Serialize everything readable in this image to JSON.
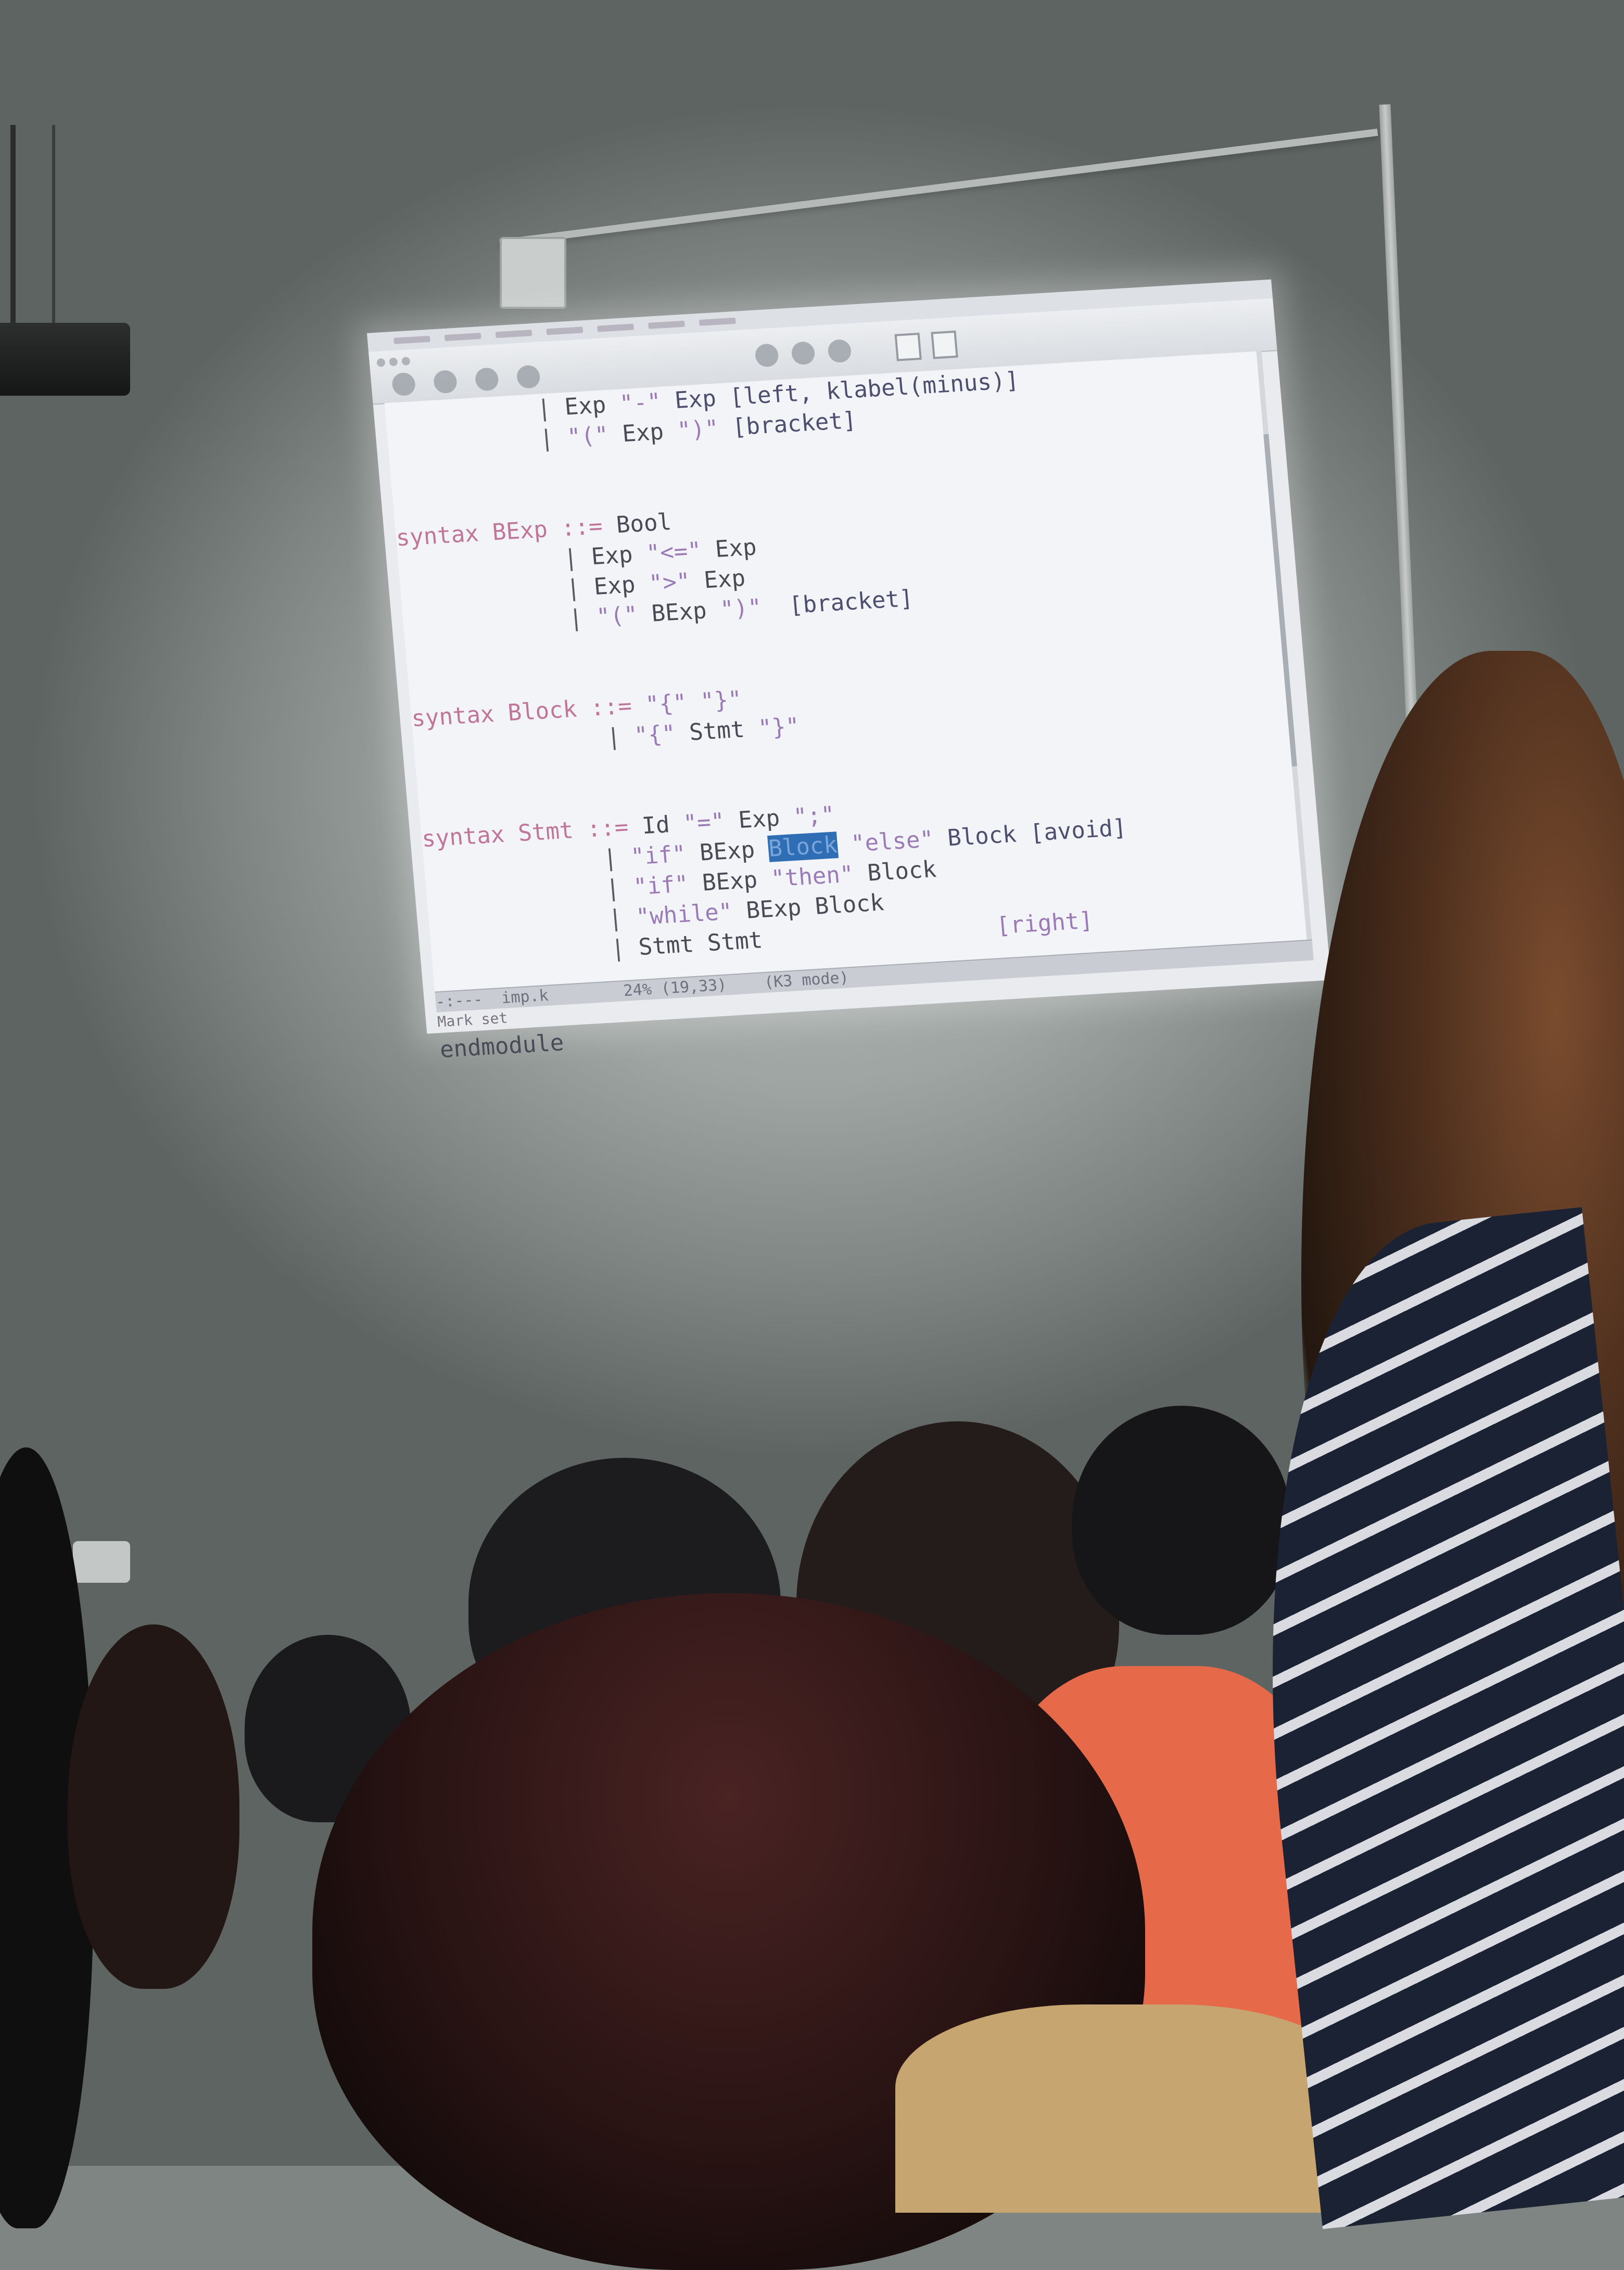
{
  "scene": {
    "description_free": true
  },
  "editor": {
    "code_lines": [
      {
        "parts": [
          {
            "t": "           ",
            "c": ""
          },
          {
            "t": "| ",
            "c": "bar"
          },
          {
            "t": "Exp ",
            "c": ""
          },
          {
            "t": "\"-\"",
            "c": "str"
          },
          {
            "t": " Exp [left, klabel(minus)]",
            "c": "attr"
          }
        ]
      },
      {
        "parts": [
          {
            "t": "           ",
            "c": ""
          },
          {
            "t": "| ",
            "c": "bar"
          },
          {
            "t": "\"(\"",
            "c": "str"
          },
          {
            "t": " Exp ",
            "c": ""
          },
          {
            "t": "\")\"",
            "c": "str"
          },
          {
            "t": " [bracket]",
            "c": "attr"
          }
        ]
      },
      {
        "parts": [
          {
            "t": "",
            "c": ""
          }
        ]
      },
      {
        "parts": [
          {
            "t": "",
            "c": ""
          }
        ]
      },
      {
        "parts": [
          {
            "t": "syntax BExp",
            "c": "kw"
          },
          {
            "t": " ::= ",
            "c": "kw"
          },
          {
            "t": "Bool",
            "c": ""
          }
        ]
      },
      {
        "parts": [
          {
            "t": "            ",
            "c": ""
          },
          {
            "t": "| ",
            "c": "bar"
          },
          {
            "t": "Exp ",
            "c": ""
          },
          {
            "t": "\"<=\"",
            "c": "str"
          },
          {
            "t": " Exp",
            "c": ""
          }
        ]
      },
      {
        "parts": [
          {
            "t": "            ",
            "c": ""
          },
          {
            "t": "| ",
            "c": "bar"
          },
          {
            "t": "Exp ",
            "c": ""
          },
          {
            "t": "\">\"",
            "c": "str"
          },
          {
            "t": " Exp",
            "c": ""
          }
        ]
      },
      {
        "parts": [
          {
            "t": "            ",
            "c": ""
          },
          {
            "t": "| ",
            "c": "bar"
          },
          {
            "t": "\"(\"",
            "c": "str"
          },
          {
            "t": " BExp ",
            "c": ""
          },
          {
            "t": "\")\"",
            "c": "str"
          },
          {
            "t": "  [bracket]",
            "c": "attr"
          }
        ]
      },
      {
        "parts": [
          {
            "t": "",
            "c": ""
          }
        ]
      },
      {
        "parts": [
          {
            "t": "",
            "c": ""
          }
        ]
      },
      {
        "parts": [
          {
            "t": "syntax Block",
            "c": "kw"
          },
          {
            "t": " ::= ",
            "c": "kw"
          },
          {
            "t": "\"{\" \"}\"",
            "c": "str"
          }
        ]
      },
      {
        "parts": [
          {
            "t": "              ",
            "c": ""
          },
          {
            "t": "| ",
            "c": "bar"
          },
          {
            "t": "\"{\"",
            "c": "str"
          },
          {
            "t": " Stmt ",
            "c": ""
          },
          {
            "t": "\"}\"",
            "c": "str"
          }
        ]
      },
      {
        "parts": [
          {
            "t": "",
            "c": ""
          }
        ]
      },
      {
        "parts": [
          {
            "t": "",
            "c": ""
          }
        ]
      },
      {
        "parts": [
          {
            "t": "syntax Stmt",
            "c": "kw"
          },
          {
            "t": " ::= ",
            "c": "kw"
          },
          {
            "t": "Id ",
            "c": ""
          },
          {
            "t": "\"=\"",
            "c": "str"
          },
          {
            "t": " Exp ",
            "c": ""
          },
          {
            "t": "\";\"",
            "c": "str"
          }
        ]
      },
      {
        "parts": [
          {
            "t": "             ",
            "c": ""
          },
          {
            "t": "| ",
            "c": "bar"
          },
          {
            "t": "\"if\"",
            "c": "str"
          },
          {
            "t": " BExp ",
            "c": ""
          },
          {
            "t": "Block",
            "c": "hl"
          },
          {
            "t": " ",
            "c": ""
          },
          {
            "t": "\"else\"",
            "c": "str"
          },
          {
            "t": " Block [avoid]",
            "c": "attr"
          }
        ]
      },
      {
        "parts": [
          {
            "t": "             ",
            "c": ""
          },
          {
            "t": "| ",
            "c": "bar"
          },
          {
            "t": "\"if\"",
            "c": "str"
          },
          {
            "t": " BExp ",
            "c": ""
          },
          {
            "t": "\"then\"",
            "c": "str"
          },
          {
            "t": " Block",
            "c": ""
          }
        ]
      },
      {
        "parts": [
          {
            "t": "             ",
            "c": ""
          },
          {
            "t": "| ",
            "c": "bar"
          },
          {
            "t": "\"while\"",
            "c": "str"
          },
          {
            "t": " BExp Block",
            "c": ""
          }
        ]
      },
      {
        "parts": [
          {
            "t": "             ",
            "c": ""
          },
          {
            "t": "| ",
            "c": "bar"
          },
          {
            "t": "Stmt Stmt",
            "c": ""
          },
          {
            "t": "                 [right]",
            "c": "str"
          }
        ]
      },
      {
        "parts": [
          {
            "t": "",
            "c": ""
          }
        ]
      },
      {
        "parts": [
          {
            "t": "",
            "c": ""
          }
        ]
      },
      {
        "parts": [
          {
            "t": "endmodule",
            "c": ""
          }
        ]
      }
    ],
    "modeline": "-:---  imp.k        24% (19,33)    (K3 mode)",
    "minibuffer": "Mark set"
  },
  "colors": {
    "keyword": "#c0769a",
    "string": "#9a7bb5",
    "highlight": "#2f6db5"
  }
}
